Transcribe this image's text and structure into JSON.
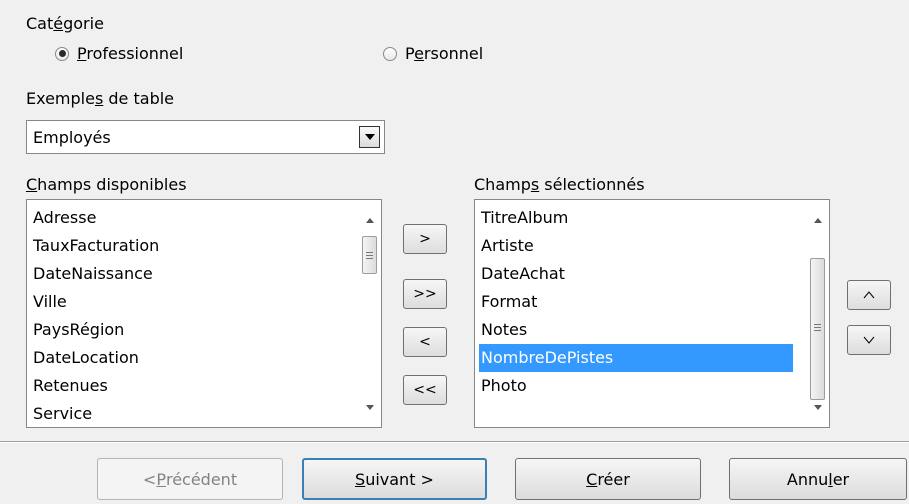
{
  "category": {
    "label_pre": "Cat",
    "label_u": "é",
    "label_post": "gorie",
    "options": [
      {
        "pre": "",
        "u": "P",
        "post": "rofessionnel",
        "selected": true
      },
      {
        "pre": "P",
        "u": "e",
        "post": "rsonnel",
        "selected": false
      }
    ]
  },
  "sample_tables": {
    "label_pre": "Exemple",
    "label_u": "s",
    "label_post": " de table",
    "selected": "Employés"
  },
  "available_fields": {
    "label_pre": "",
    "label_u": "C",
    "label_post": "hamps disponibles",
    "items": [
      "Adresse",
      "TauxFacturation",
      "DateNaissance",
      "Ville",
      "PaysRégion",
      "DateLocation",
      "Retenues",
      "Service"
    ]
  },
  "selected_fields": {
    "label_pre": "Champ",
    "label_u": "s",
    "label_post": " sélectionnés",
    "items": [
      "TitreAlbum",
      "Artiste",
      "DateAchat",
      "Format",
      "Notes",
      "NombreDePistes",
      "Photo"
    ],
    "highlighted_index": 5
  },
  "move_buttons": {
    "add": ">",
    "add_all": ">>",
    "remove": "<",
    "remove_all": "<<"
  },
  "order_buttons": {
    "up": "^",
    "down": "v"
  },
  "footer": {
    "prev_pre": "< ",
    "prev_u": "P",
    "prev_post": "récédent",
    "next_pre": "",
    "next_u": "S",
    "next_post": "uivant >",
    "create_pre": "",
    "create_u": "C",
    "create_post": "réer",
    "cancel_pre": "Annu",
    "cancel_u": "l",
    "cancel_post": "er"
  },
  "colors": {
    "selection": "#3399ff",
    "default_button_border": "#3c7fb1"
  }
}
